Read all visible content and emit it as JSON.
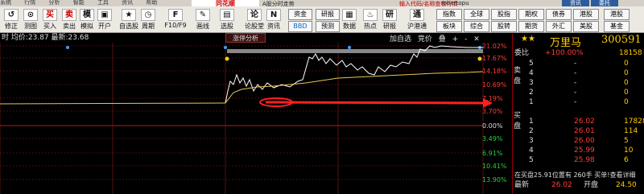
{
  "menu": {
    "items": [
      "系统",
      "行情",
      "分析",
      "智能",
      "工具",
      "资讯",
      "帮助"
    ],
    "brand": "同花顺",
    "center": "A股分时走势",
    "search_hint": "输入代码/名称查看行情",
    "user": "robertopu",
    "win_buttons": [
      "资讯",
      "委托"
    ]
  },
  "toolbar": {
    "left": [
      {
        "label": "修正",
        "icon": "↺"
      },
      {
        "label": "测图",
        "icon": "⊙"
      },
      {
        "label": "买入",
        "icon": "买"
      },
      {
        "label": "卖出",
        "icon": "卖"
      },
      {
        "label": "模拟",
        "icon": "模"
      },
      {
        "label": "开户",
        "icon": "▣"
      },
      {
        "label": "自选股",
        "icon": "★"
      },
      {
        "label": "周期",
        "icon": "◷"
      },
      {
        "label": "F10/F9",
        "icon": "F"
      },
      {
        "label": "画线",
        "icon": "✎"
      },
      {
        "label": "选股",
        "icon": "▤"
      },
      {
        "label": "论股堂",
        "icon": "论"
      },
      {
        "label": "资讯",
        "icon": "N"
      },
      {
        "label": "数据",
        "icon": "▦"
      },
      {
        "label": "热点",
        "icon": "♨"
      },
      {
        "label": "研报",
        "icon": "研"
      },
      {
        "label": "沪港通",
        "icon": "通"
      }
    ],
    "mid_boxes": [
      "资金",
      "研报",
      "BBD",
      "预测"
    ],
    "right_boxes": [
      [
        "指数",
        "全球",
        "股指",
        "期权",
        "债券",
        "港股"
      ],
      [
        "板块",
        "综合",
        "股转",
        "期货",
        "外汇",
        "美股"
      ]
    ],
    "extra_top": "港股",
    "extra_bottom": "基金"
  },
  "chart": {
    "header": "时 均价:23.87 最新:23.68",
    "tab_analysis": "涨停分析",
    "tools": [
      "加自选",
      "竞价",
      "叠",
      "+",
      "-",
      "✕"
    ],
    "right_pcts": [
      "21.02%",
      "17.67%",
      "14.18%",
      "10.69%",
      "7.19%",
      "3.70%",
      "0.00%",
      "3.49%",
      "6.91%",
      "10.41%",
      "13.90%"
    ],
    "colors": {
      "up": "#ff3b3b",
      "down": "#2ecc40",
      "price": "#ffffff",
      "avg": "#e6c850",
      "grid": "#8b1a1a"
    }
  },
  "panel": {
    "stars": "★★",
    "name": "万里马",
    "code": "300591",
    "weibi_label": "委比",
    "weibi_value": "+100.00%",
    "weicha_value": "18158",
    "sell_side": "卖盘",
    "buy_side": "买盘",
    "sell": [
      {
        "lvl": "5",
        "price": "-",
        "vol": "0"
      },
      {
        "lvl": "4",
        "price": "-",
        "vol": "0"
      },
      {
        "lvl": "3",
        "price": "-",
        "vol": "0"
      },
      {
        "lvl": "2",
        "price": "-",
        "vol": "0"
      },
      {
        "lvl": "1",
        "price": "-",
        "vol": "0"
      }
    ],
    "buy": [
      {
        "lvl": "1",
        "price": "26.02",
        "vol": "17828"
      },
      {
        "lvl": "2",
        "price": "26.01",
        "vol": "114"
      },
      {
        "lvl": "3",
        "price": "26.00",
        "vol": "5"
      },
      {
        "lvl": "4",
        "price": "25.99",
        "vol": "10"
      },
      {
        "lvl": "5",
        "price": "25.98",
        "vol": "6"
      }
    ],
    "notice": "在买盘25.91位置有 260手 买单!查看详细",
    "latest_label": "最新",
    "latest_value": "26.02",
    "open_label": "开盘",
    "open_value": "24.50"
  }
}
